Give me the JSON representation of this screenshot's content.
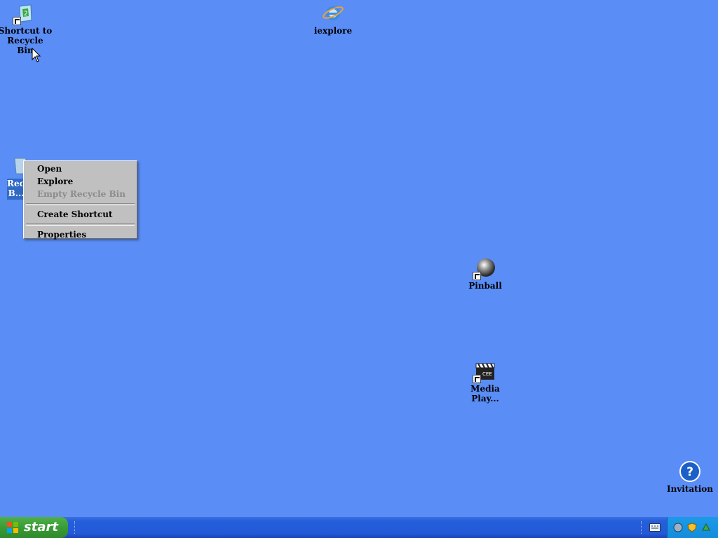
{
  "desktop": {
    "icons": [
      {
        "name": "shortcut-recycle-bin",
        "label": "Shortcut to Recycle Bin"
      },
      {
        "name": "iexplore",
        "label": "iexplore"
      },
      {
        "name": "pinball",
        "label": "Pinball"
      },
      {
        "name": "media-player",
        "label": "Media Play..."
      },
      {
        "name": "invitation",
        "label": "Invitation"
      }
    ],
    "selected_icon_label": "Rec... B..."
  },
  "context_menu": {
    "items": [
      {
        "label": "Open",
        "bold": true,
        "enabled": true
      },
      {
        "label": "Explore",
        "bold": false,
        "enabled": true
      },
      {
        "label": "Empty Recycle Bin",
        "bold": false,
        "enabled": false
      },
      {
        "label": "Create Shortcut",
        "bold": false,
        "enabled": true
      },
      {
        "label": "Properties",
        "bold": false,
        "enabled": true
      }
    ]
  },
  "taskbar": {
    "start_label": "start"
  },
  "colors": {
    "desktop": "#5a8df6",
    "taskbar": "#245edb",
    "start": "#3a9c36",
    "menu": "#c0c0c0"
  }
}
